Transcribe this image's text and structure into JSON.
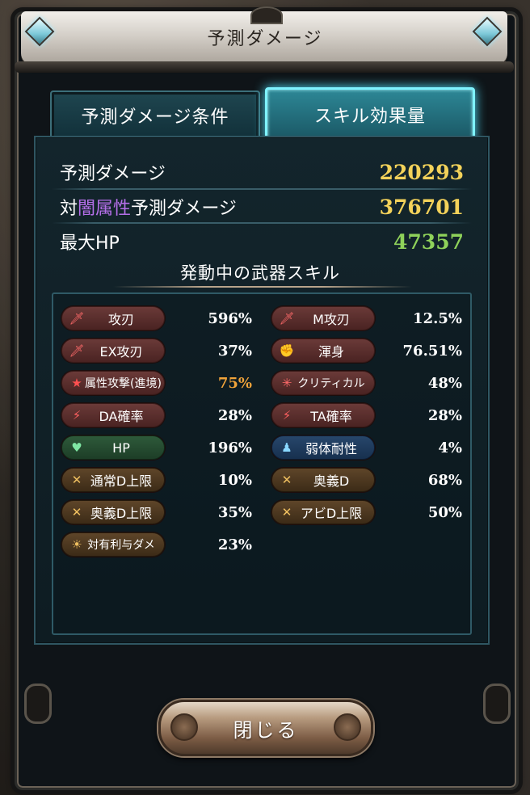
{
  "window": {
    "title": "予測ダメージ"
  },
  "tabs": [
    {
      "label": "予測ダメージ条件",
      "active": false
    },
    {
      "label": "スキル効果量",
      "active": true
    }
  ],
  "stats": {
    "predicted_damage": {
      "label": "予測ダメージ",
      "value": "220293",
      "color": "#f3d25a"
    },
    "vs_element": {
      "label_prefix": "対",
      "element": "闇属性",
      "label_suffix": "予測ダメージ",
      "value": "376701",
      "color": "#f3d25a",
      "element_color": "#b46fe8"
    },
    "max_hp": {
      "label": "最大HP",
      "value": "47357",
      "color": "#8fd25a"
    }
  },
  "skills_section": {
    "title": "発動中の武器スキル"
  },
  "skills_left": [
    {
      "label": "攻刃",
      "icon": "sword-icon",
      "value": "596%",
      "color": "red",
      "value_color": "#ffffff"
    },
    {
      "label": "EX攻刃",
      "icon": "sword-icon",
      "value": "37%",
      "color": "red",
      "value_color": "#ffffff"
    },
    {
      "label": "属性攻撃(進境)",
      "icon": "star-icon",
      "value": "75%",
      "color": "red",
      "value_color": "#f0a33a"
    },
    {
      "label": "DA確率",
      "icon": "double-slash-icon",
      "value": "28%",
      "color": "red",
      "value_color": "#ffffff"
    },
    {
      "label": "HP",
      "icon": "heart-icon",
      "value": "196%",
      "color": "green",
      "value_color": "#ffffff"
    },
    {
      "label": "通常D上限",
      "icon": "cap-icon",
      "value": "10%",
      "color": "brown",
      "value_color": "#ffffff"
    },
    {
      "label": "奥義D上限",
      "icon": "cap-icon",
      "value": "35%",
      "color": "brown",
      "value_color": "#ffffff"
    },
    {
      "label": "対有利与ダメ",
      "icon": "sun-icon",
      "value": "23%",
      "color": "brown",
      "value_color": "#ffffff"
    }
  ],
  "skills_right": [
    {
      "label": "M攻刃",
      "icon": "sword-icon",
      "value": "12.5%",
      "color": "red",
      "value_color": "#ffffff"
    },
    {
      "label": "渾身",
      "icon": "muscle-icon",
      "value": "76.51%",
      "color": "red",
      "value_color": "#ffffff"
    },
    {
      "label": "クリティカル",
      "icon": "burst-icon",
      "value": "48%",
      "color": "red",
      "value_color": "#ffffff"
    },
    {
      "label": "TA確率",
      "icon": "triple-slash-icon",
      "value": "28%",
      "color": "red",
      "value_color": "#ffffff"
    },
    {
      "label": "弱体耐性",
      "icon": "shield-figure-icon",
      "value": "4%",
      "color": "blue",
      "value_color": "#ffffff"
    },
    {
      "label": "奥義D",
      "icon": "cross-swords-icon",
      "value": "68%",
      "color": "brown",
      "value_color": "#ffffff"
    },
    {
      "label": "アビD上限",
      "icon": "cap-icon",
      "value": "50%",
      "color": "brown",
      "value_color": "#ffffff"
    }
  ],
  "buttons": {
    "close_label": "閉じる"
  }
}
